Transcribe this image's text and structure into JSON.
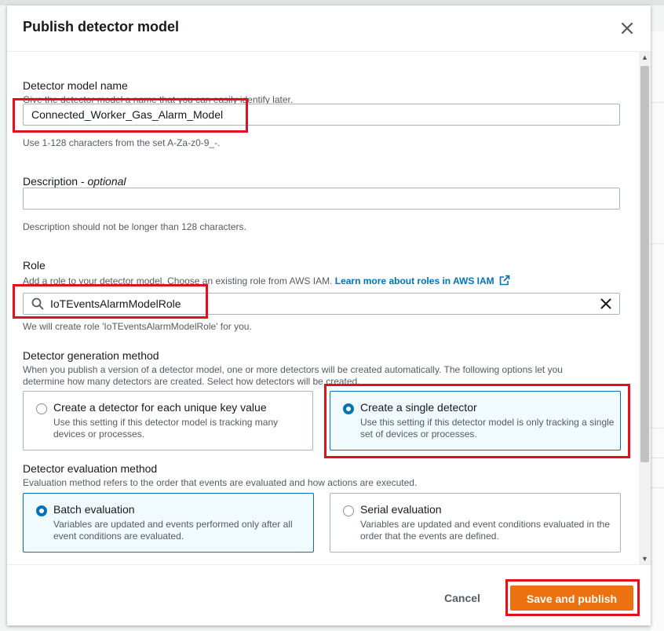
{
  "modal": {
    "title": "Publish detector model",
    "close_icon": "close-icon"
  },
  "name_field": {
    "label": "Detector model name",
    "description": "Give the detector model a name that you can easily identify later.",
    "value": "Connected_Worker_Gas_Alarm_Model",
    "constraint": "Use 1-128 characters from the set A-Za-z0-9_-."
  },
  "description_field": {
    "label": "Description",
    "optional": "optional",
    "value": "",
    "constraint": "Description should not be longer than 128 characters."
  },
  "role_field": {
    "label": "Role",
    "description": "Add a role to your detector model. Choose an existing role from AWS IAM.",
    "link_text": "Learn more about roles in AWS IAM",
    "link_icon": "external-link-icon",
    "search_icon": "search-icon",
    "value": "IoTEventsAlarmModelRole",
    "clear_icon": "clear-icon",
    "note": "We will create role 'IoTEventsAlarmModelRole' for you."
  },
  "generation_method": {
    "label": "Detector generation method",
    "description_line1": "When you publish a version of a detector model, one or more detectors will be created automatically. The following options let you",
    "description_line2": "determine how many detectors are created. Select how detectors will be created.",
    "options": [
      {
        "title": "Create a detector for each unique key value",
        "desc": "Use this setting if this detector model is tracking many devices or processes.",
        "selected": false
      },
      {
        "title": "Create a single detector",
        "desc": "Use this setting if this detector model is only tracking a single set of devices or processes.",
        "selected": true
      }
    ]
  },
  "evaluation_method": {
    "label": "Detector evaluation method",
    "description": "Evaluation method refers to the order that events are evaluated and how actions are executed.",
    "options": [
      {
        "title": "Batch evaluation",
        "desc": "Variables are updated and events performed only after all event conditions are evaluated.",
        "selected": true
      },
      {
        "title": "Serial evaluation",
        "desc": "Variables are updated and event conditions evaluated in the order that the events are defined.",
        "selected": false
      }
    ]
  },
  "footer": {
    "cancel_label": "Cancel",
    "save_label": "Save and publish"
  },
  "colors": {
    "accent": "#0073bb",
    "primary_button": "#ec7211",
    "highlight": "#e0101d"
  }
}
